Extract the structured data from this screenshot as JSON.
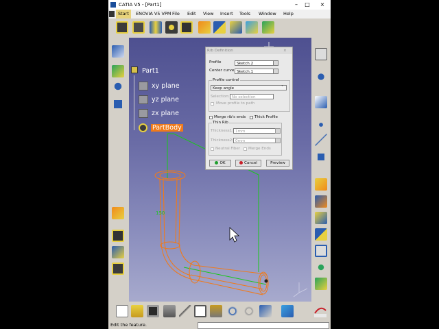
{
  "window": {
    "title": "CATIA V5 - [Part1]"
  },
  "menu": {
    "start": "Start",
    "items": [
      "ENOVIA V5 VPM",
      "File",
      "Edit",
      "View",
      "Insert",
      "Tools",
      "Window",
      "Help"
    ]
  },
  "tree": {
    "root": "Part1",
    "children": [
      "xy plane",
      "yz plane",
      "zx plane"
    ],
    "active": "PartBody"
  },
  "dialog": {
    "title": "Rib Definition",
    "profile_label": "Profile",
    "profile_value": "Sketch.2",
    "center_curve_label": "Center curve",
    "center_curve_value": "Sketch.1",
    "profile_control_group": "Profile control",
    "profile_control_value": "Keep angle",
    "selection_label": "Selection:",
    "selection_value": "No selection",
    "move_profile_label": "Move profile to path",
    "merge_ends_label": "Merge rib's ends",
    "thick_profile_label": "Thick Profile",
    "thin_rib_group": "Thin Rib",
    "thickness1_label": "Thickness1:",
    "thickness1_value": "1mm",
    "thickness2_label": "Thickness2:",
    "thickness2_value": "0mm",
    "neutral_fiber_label": "Neutral Fiber",
    "merge_ends2_label": "Merge Ends",
    "ok_label": "OK",
    "cancel_label": "Cancel",
    "preview_label": "Preview"
  },
  "viewport": {
    "dimension_label": "150"
  },
  "status": {
    "text": "Edit the feature."
  },
  "colors": {
    "accent": "#f07a1a",
    "geometry": "#f07a1a",
    "sketch": "#19c819"
  }
}
